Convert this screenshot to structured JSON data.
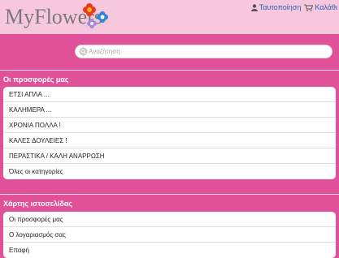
{
  "header": {
    "logo_text": "MyFlowers",
    "login_label": "Ταυτοποίηση",
    "cart_label": "Καλάθι"
  },
  "search": {
    "placeholder": "Αναζήτηση"
  },
  "offers": {
    "title": "Οι προσφορές μας",
    "items": [
      "ΕΤΣΙ ΑΠΛΑ ...",
      "ΚΑΛΗΜΕΡΑ ...",
      "ΧΡΟΝΙΑ ΠΟΛΛΑ !",
      "ΚΑΛΕΣ ΔΟΥΛΕΙΕΣ !",
      "ΠΕΡΑΣΤΙΚΑ / ΚΑΛΗ ΑΝΑΡΡΩΣΗ",
      "Όλες οι κατηγορίες"
    ]
  },
  "sitemap": {
    "title": "Χάρτης ιστοσελίδας",
    "items": [
      "Οι προσφορές μας",
      "Ο λογαριασμός σας",
      "Επαφή"
    ]
  },
  "colors": {
    "background": "#e0519a",
    "header": "#f7c8dd",
    "link": "#2a62b6"
  },
  "icons": [
    "flowers-icon",
    "user-icon",
    "cart-icon",
    "search-icon"
  ]
}
